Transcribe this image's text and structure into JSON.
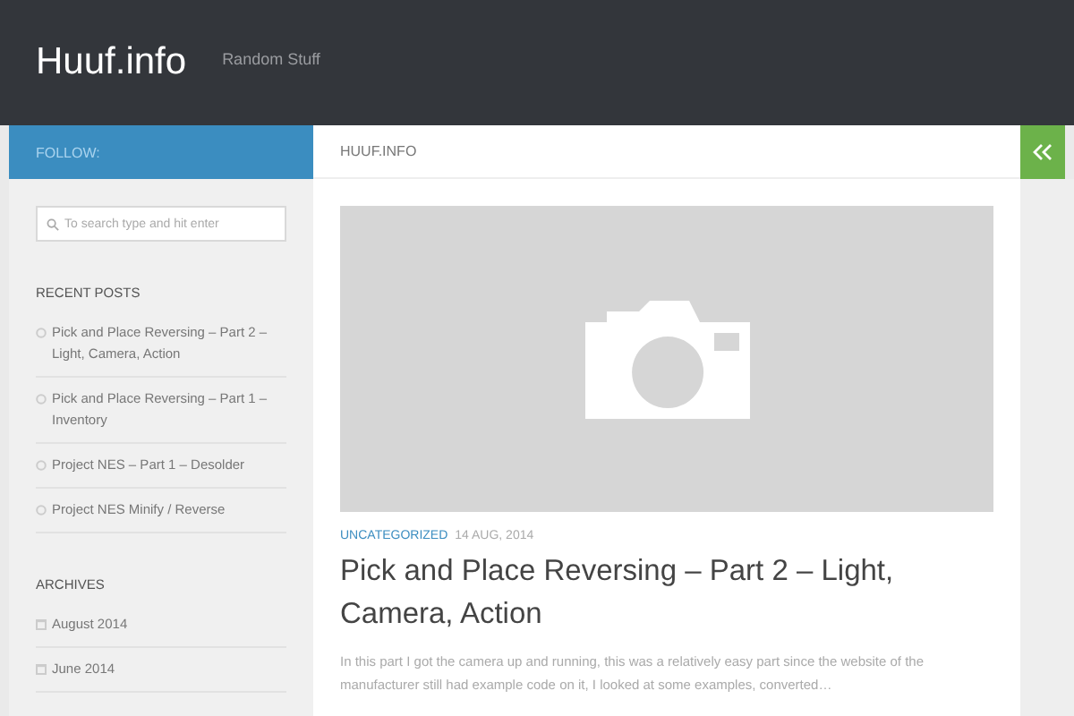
{
  "header": {
    "site_title": "Huuf.info",
    "tagline": "Random Stuff"
  },
  "sidebar": {
    "heading": "FOLLOW:",
    "search": {
      "placeholder": "To search type and hit enter"
    },
    "widgets": [
      {
        "kind": "posts",
        "title": "RECENT POSTS",
        "items": [
          "Pick and Place Reversing – Part 2 – Light, Camera, Action",
          "Pick and Place Reversing – Part 1 – Inventory",
          "Project NES – Part 1 – Desolder",
          "Project NES Minify / Reverse"
        ]
      },
      {
        "kind": "archives",
        "title": "ARCHIVES",
        "items": [
          "August 2014",
          "June 2014"
        ]
      }
    ]
  },
  "main": {
    "heading": "HUUF.INFO",
    "post": {
      "category": "UNCATEGORIZED",
      "date": "14 AUG, 2014",
      "title": "Pick and Place Reversing – Part 2 – Light, Camera, Action",
      "excerpt": "In this part I got the camera up and running, this was a relatively easy part since the website of the manufacturer still had example code on it, I looked at some examples, converted…"
    }
  }
}
